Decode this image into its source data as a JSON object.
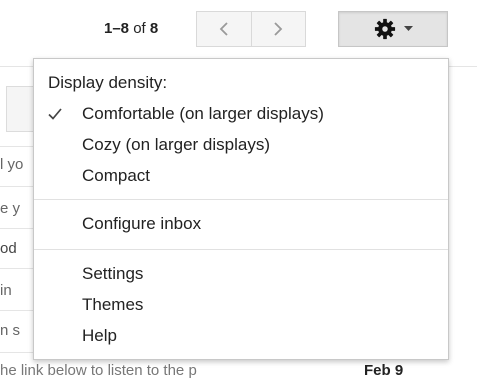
{
  "toolbar": {
    "pager_range": "1–8",
    "pager_of": "of",
    "pager_total": "8",
    "prev_icon": "chevron-left-icon",
    "next_icon": "chevron-right-icon",
    "settings_icon": "gear-icon",
    "settings_caret_icon": "caret-down-icon"
  },
  "background": {
    "fragments": [
      "l yo",
      "e y",
      "od",
      "in",
      "n s"
    ],
    "bottom_snippet": "he link below to listen to the p",
    "bottom_date": "Feb 9"
  },
  "menu": {
    "density_header": "Display density:",
    "density_options": [
      {
        "label": "Comfortable (on larger displays)",
        "checked": true
      },
      {
        "label": "Cozy (on larger displays)",
        "checked": false
      },
      {
        "label": "Compact",
        "checked": false
      }
    ],
    "configure_inbox": "Configure inbox",
    "settings": "Settings",
    "themes": "Themes",
    "help": "Help"
  },
  "colors": {
    "menu_border": "#c8c8c8",
    "button_bg": "#e4e4e4",
    "nav_bg": "#f5f5f5",
    "text": "#222222"
  }
}
